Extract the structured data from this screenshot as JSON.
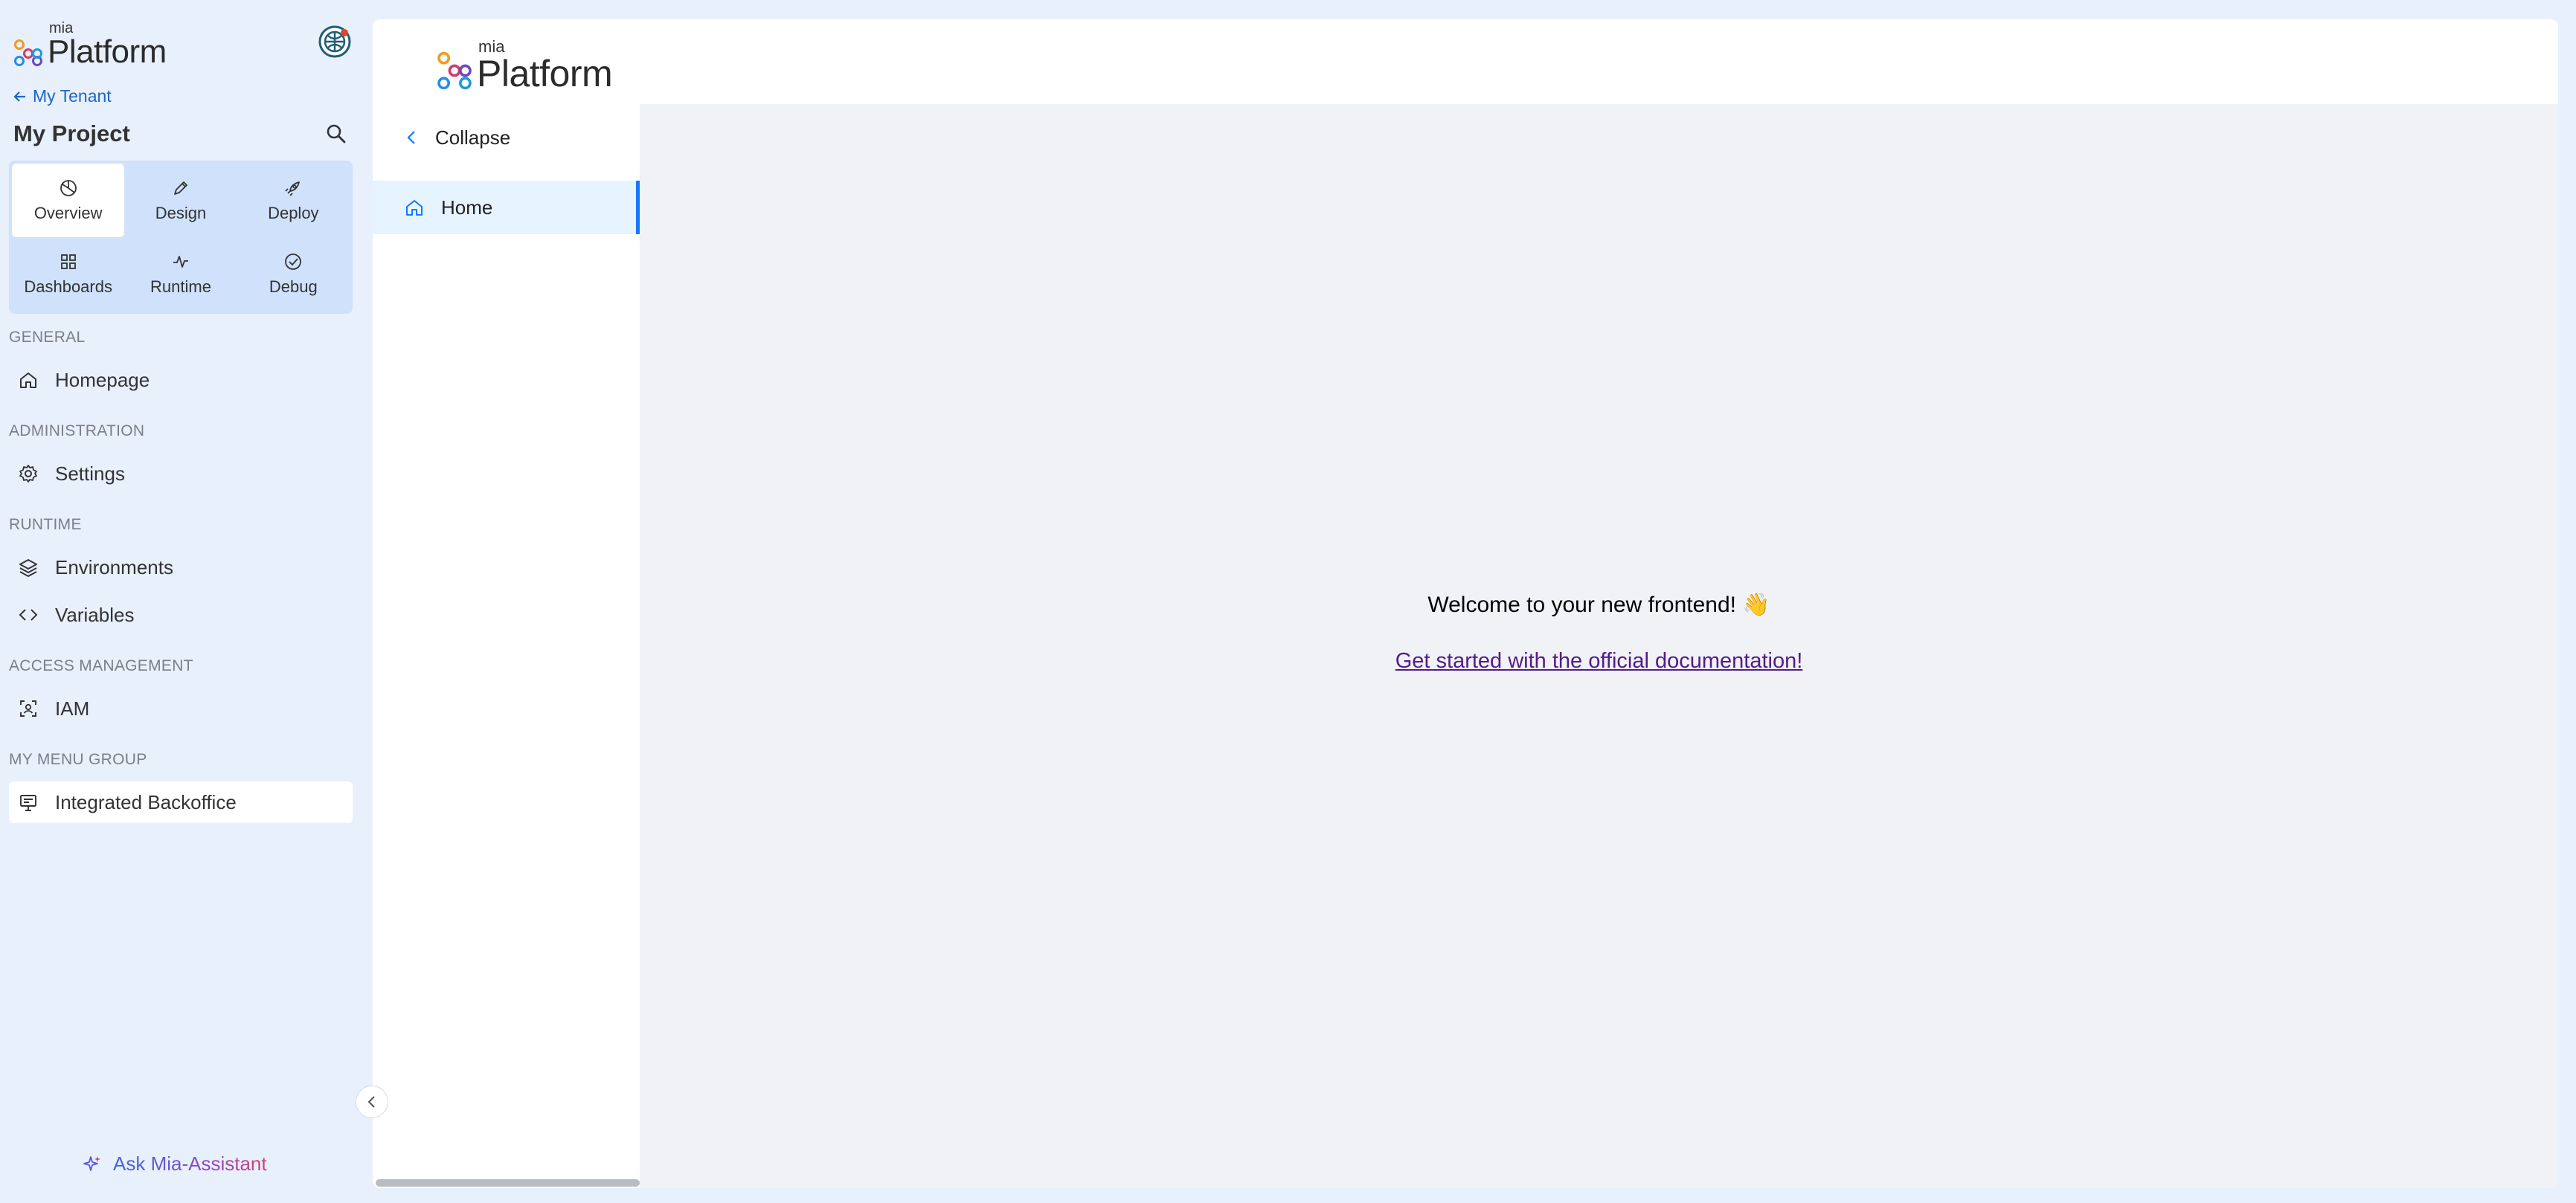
{
  "colors": {
    "accent": "#1677ff",
    "link": "#1a67c6",
    "visited_link": "#551a8b",
    "sidebar_bg": "#e8f0fc",
    "sections_bg": "#cfe1fb"
  },
  "sidebar": {
    "logo": {
      "small": "mia",
      "large": "Platform"
    },
    "back_link": "My Tenant",
    "project_title": "My Project",
    "sections": [
      {
        "label": "Overview",
        "icon": "pie-chart-icon",
        "active": true
      },
      {
        "label": "Design",
        "icon": "pencil-icon",
        "active": false
      },
      {
        "label": "Deploy",
        "icon": "rocket-icon",
        "active": false
      },
      {
        "label": "Dashboards",
        "icon": "grid-icon",
        "active": false
      },
      {
        "label": "Runtime",
        "icon": "activity-icon",
        "active": false
      },
      {
        "label": "Debug",
        "icon": "check-circle-icon",
        "active": false
      }
    ],
    "groups": [
      {
        "title": "GENERAL",
        "items": [
          {
            "label": "Homepage",
            "icon": "home-icon"
          }
        ]
      },
      {
        "title": "ADMINISTRATION",
        "items": [
          {
            "label": "Settings",
            "icon": "gear-icon"
          }
        ]
      },
      {
        "title": "RUNTIME",
        "items": [
          {
            "label": "Environments",
            "icon": "layers-icon"
          },
          {
            "label": "Variables",
            "icon": "code-icon"
          }
        ]
      },
      {
        "title": "ACCESS MANAGEMENT",
        "items": [
          {
            "label": "IAM",
            "icon": "user-scan-icon"
          }
        ]
      },
      {
        "title": "MY MENU GROUP",
        "items": [
          {
            "label": "Integrated Backoffice",
            "icon": "backoffice-icon",
            "active": true
          }
        ]
      }
    ],
    "assistant": "Ask Mia-Assistant"
  },
  "frame": {
    "logo": {
      "small": "mia",
      "large": "Platform"
    },
    "menu": {
      "collapse_label": "Collapse",
      "home_label": "Home"
    },
    "content": {
      "welcome": "Welcome to your new frontend! 👋",
      "doc_link": "Get started with the official documentation!"
    }
  }
}
